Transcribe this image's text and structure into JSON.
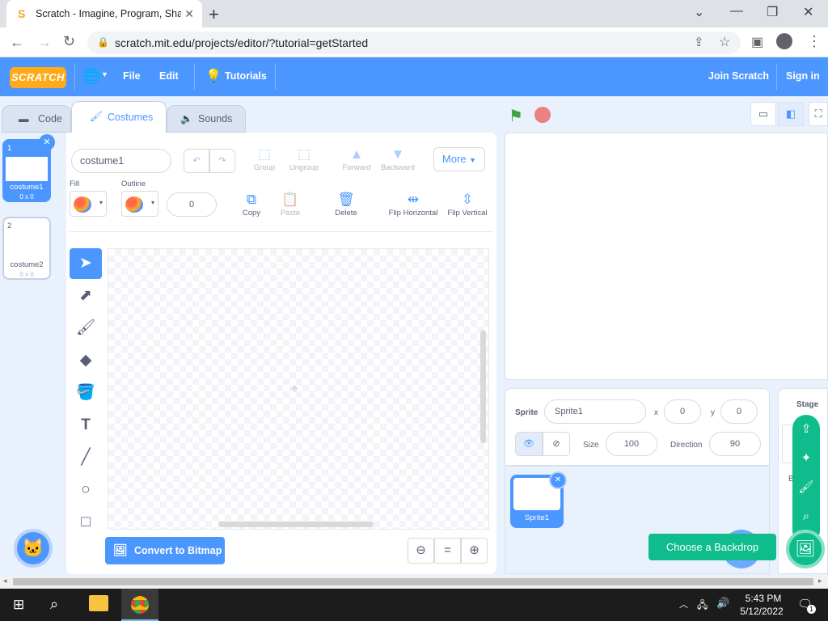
{
  "browser": {
    "tab_title": "Scratch - Imagine, Program, Sha",
    "tab_close": "✕",
    "new_tab": "+",
    "url": "scratch.mit.edu/projects/editor/?tutorial=getStarted"
  },
  "menubar": {
    "logo": "SCRATCH",
    "file": "File",
    "edit": "Edit",
    "tutorials": "Tutorials",
    "join": "Join Scratch",
    "signin": "Sign in"
  },
  "tabs": {
    "code": "Code",
    "costumes": "Costumes",
    "sounds": "Sounds"
  },
  "costumes": [
    {
      "num": "1",
      "name": "costume1",
      "size": "0 x 0"
    },
    {
      "num": "2",
      "name": "costume2",
      "size": "0 x 0"
    }
  ],
  "paint": {
    "costume_name": "costume1",
    "group": "Group",
    "ungroup": "Ungroup",
    "forward": "Forward",
    "backward": "Backward",
    "more": "More",
    "fill_label": "Fill",
    "outline_label": "Outline",
    "outline_width": "0",
    "copy": "Copy",
    "paste": "Paste",
    "delete": "Delete",
    "flip_h": "Flip Horizontal",
    "flip_v": "Flip Vertical",
    "convert": "Convert to Bitmap"
  },
  "sprite": {
    "label": "Sprite",
    "name": "Sprite1",
    "x_label": "x",
    "x": "0",
    "y_label": "y",
    "y": "0",
    "size_label": "Size",
    "size": "100",
    "direction_label": "Direction",
    "direction": "90",
    "thumb_name": "Sprite1"
  },
  "stage": {
    "label": "Stage",
    "backdrops_partial": "B      s",
    "choose_backdrop": "Choose a Backdrop"
  },
  "taskbar": {
    "time": "5:43 PM",
    "date": "5/12/2022",
    "notification_count": "1"
  },
  "colors": {
    "scratch_blue": "#4c97ff",
    "backdrop_green": "#0fbd8c"
  }
}
